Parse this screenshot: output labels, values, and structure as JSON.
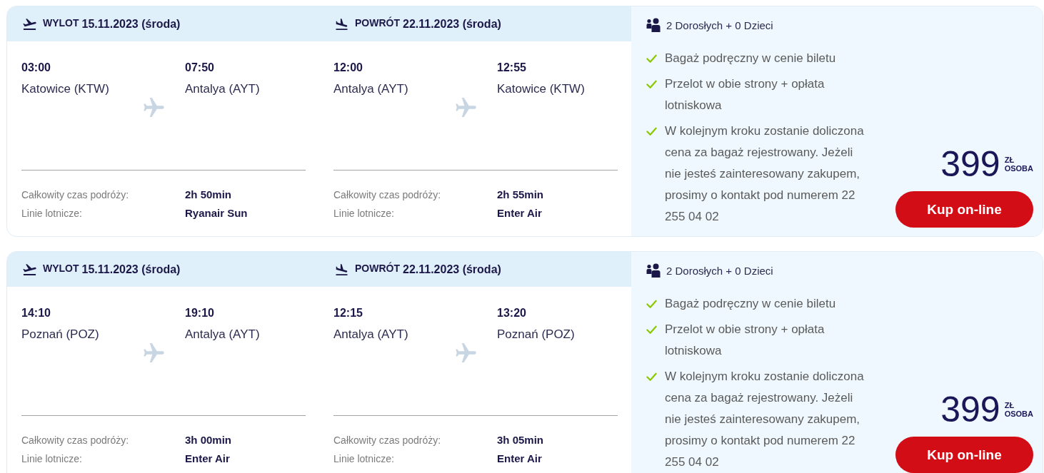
{
  "offers": [
    {
      "legs": [
        {
          "kind": "departure",
          "label": "WYLOT",
          "date": "15.11.2023 (środa)",
          "from": {
            "time": "03:00",
            "city": "Katowice (KTW)"
          },
          "to": {
            "time": "07:50",
            "city": "Antalya (AYT)"
          },
          "details": [
            {
              "label": "Całkowity czas podróży:",
              "value": "2h 50min"
            },
            {
              "label": "Linie lotnicze:",
              "value": "Ryanair Sun"
            }
          ]
        },
        {
          "kind": "return",
          "label": "POWRÓT",
          "date": "22.11.2023 (środa)",
          "from": {
            "time": "12:00",
            "city": "Antalya (AYT)"
          },
          "to": {
            "time": "12:55",
            "city": "Katowice (KTW)"
          },
          "details": [
            {
              "label": "Całkowity czas podróży:",
              "value": "2h 55min"
            },
            {
              "label": "Linie lotnicze:",
              "value": "Enter Air"
            }
          ]
        }
      ],
      "passengers": "2 Dorosłych + 0 Dzieci",
      "features": [
        "Bagaż podręczny w cenie biletu",
        "Przelot w obie strony + opłata lotniskowa",
        "W kolejnym kroku zostanie doliczona cena za bagaż rejestrowany. Jeżeli nie jesteś zainteresowany zakupem, prosimy o kontakt pod numerem 22 255 04 02"
      ],
      "price": "399",
      "currency": "ZŁ",
      "per": "OSOBA",
      "button": "Kup on-line"
    },
    {
      "legs": [
        {
          "kind": "departure",
          "label": "WYLOT",
          "date": "15.11.2023 (środa)",
          "from": {
            "time": "14:10",
            "city": "Poznań (POZ)"
          },
          "to": {
            "time": "19:10",
            "city": "Antalya (AYT)"
          },
          "details": [
            {
              "label": "Całkowity czas podróży:",
              "value": "3h 00min"
            },
            {
              "label": "Linie lotnicze:",
              "value": "Enter Air"
            }
          ]
        },
        {
          "kind": "return",
          "label": "POWRÓT",
          "date": "22.11.2023 (środa)",
          "from": {
            "time": "12:15",
            "city": "Antalya (AYT)"
          },
          "to": {
            "time": "13:20",
            "city": "Poznań (POZ)"
          },
          "details": [
            {
              "label": "Całkowity czas podróży:",
              "value": "3h 05min"
            },
            {
              "label": "Linie lotnicze:",
              "value": "Enter Air"
            }
          ]
        }
      ],
      "passengers": "2 Dorosłych + 0 Dzieci",
      "features": [
        "Bagaż podręczny w cenie biletu",
        "Przelot w obie strony + opłata lotniskowa",
        "W kolejnym kroku zostanie doliczona cena za bagaż rejestrowany. Jeżeli nie jesteś zainteresowany zakupem, prosimy o kontakt pod numerem 22 255 04 02"
      ],
      "price": "399",
      "currency": "ZŁ",
      "per": "OSOBA",
      "button": "Kup on-line"
    }
  ]
}
